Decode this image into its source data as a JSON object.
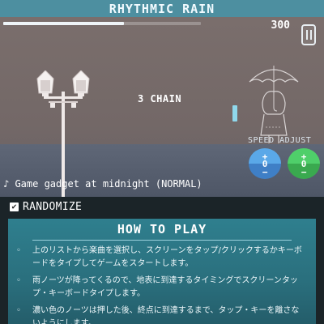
{
  "header": {
    "title": "RHYTHMIC RAIN"
  },
  "game": {
    "progress": 0.61,
    "score": "300",
    "chain": "3 CHAIN",
    "song": "♪ Game gadget at midnight (NORMAL)",
    "pause_icon": "pause-icon",
    "colors": {
      "sky": "#756a69",
      "note": "#8fd8ec",
      "speed_left": "#5aa8e8",
      "speed_right": "#4fcf6a"
    }
  },
  "speed_adjust": {
    "label": "SPEED ADJUST",
    "left": {
      "up": "+",
      "value": "0",
      "down": "−"
    },
    "right": {
      "up": "+",
      "value": "0",
      "down": "−"
    }
  },
  "options": {
    "randomize_label": "RANDOMIZE",
    "randomize_checked": true,
    "check_mark": "✔"
  },
  "howto": {
    "title": "HOW TO PLAY",
    "bullet": "◦",
    "items": [
      "上のリストから楽曲を選択し、スクリーンをタップ/クリックするかキーボードをタイプしてゲームをスタートします。",
      "雨ノーツが降ってくるので、地表に到達するタイミングでスクリーンタップ・キーボードタイプします。",
      "濃い色のノーツは押した後、終点に到達するまで、タップ・キーを離さないようにします。"
    ]
  }
}
